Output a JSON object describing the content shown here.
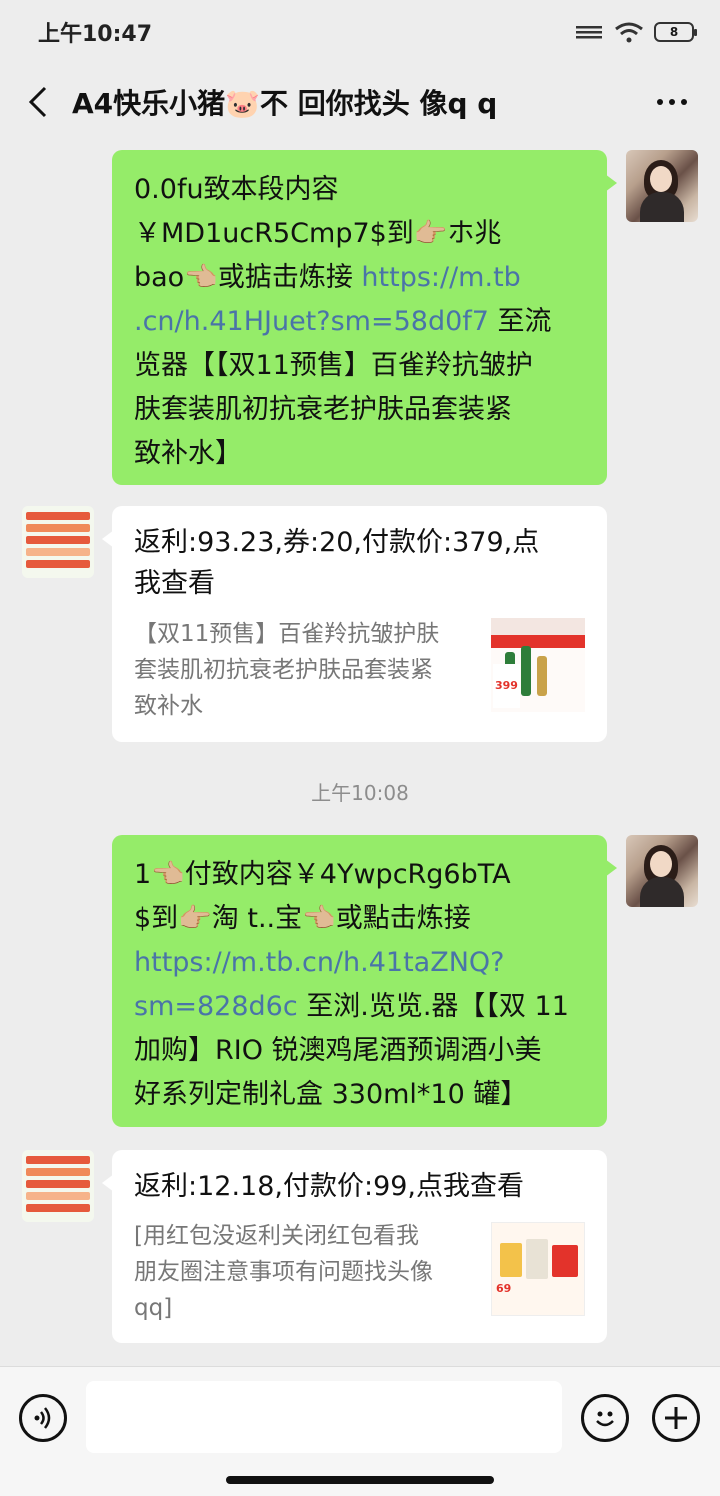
{
  "status_bar": {
    "time": "上午10:47",
    "battery": "8"
  },
  "nav": {
    "title": "A4快乐小猪🐷不 回你找头 像q q"
  },
  "messages": [
    {
      "text_parts": [
        "0.0fu致本段内容\n￥MD1ucR5Cmp7$到👉🏼ホ兆\nbao👈🏼或掂击炼接 ",
        "https://m.tb\n.cn/h.41HJuet?sm=58d0f7",
        " 至流\n览器【【双11预售】百雀羚抗皱护\n肤套装肌初抗衰老护肤品套装紧\n致补水】"
      ]
    },
    {
      "title": "返利:93.23,券:20,付款价:379,点\n我查看",
      "desc": "【双11预售】百雀羚抗皱护肤\n套装肌初抗衰老护肤品套装紧\n致补水",
      "thumb_price": "399"
    },
    {
      "timestamp": "上午10:08"
    },
    {
      "text_parts": [
        "1👈🏼付致内容￥4YwpcRg6bTA\n$到👉🏼淘 t..宝👈🏼或點击炼接\n",
        "https://m.tb.cn/h.41taZNQ?\nsm=828d6c",
        " 至浏.览览.器【【双 11\n加购】RIO 锐澳鸡尾酒预调酒小美\n好系列定制礼盒 330ml*10 罐】"
      ]
    },
    {
      "title": "返利:12.18,付款价:99,点我查看",
      "desc": "[用红包没返利关闭红包看我\n朋友圈注意事项有问题找头像\nqq]",
      "thumb_price": "69"
    }
  ],
  "colors": {
    "bubble_green": "#95ec69",
    "link": "#4a74a8",
    "background": "#ededed"
  },
  "icons": [
    "back-icon",
    "more-icon",
    "voice-icon",
    "emoji-icon",
    "plus-icon",
    "signal-icon",
    "wifi-icon",
    "battery-icon"
  ]
}
